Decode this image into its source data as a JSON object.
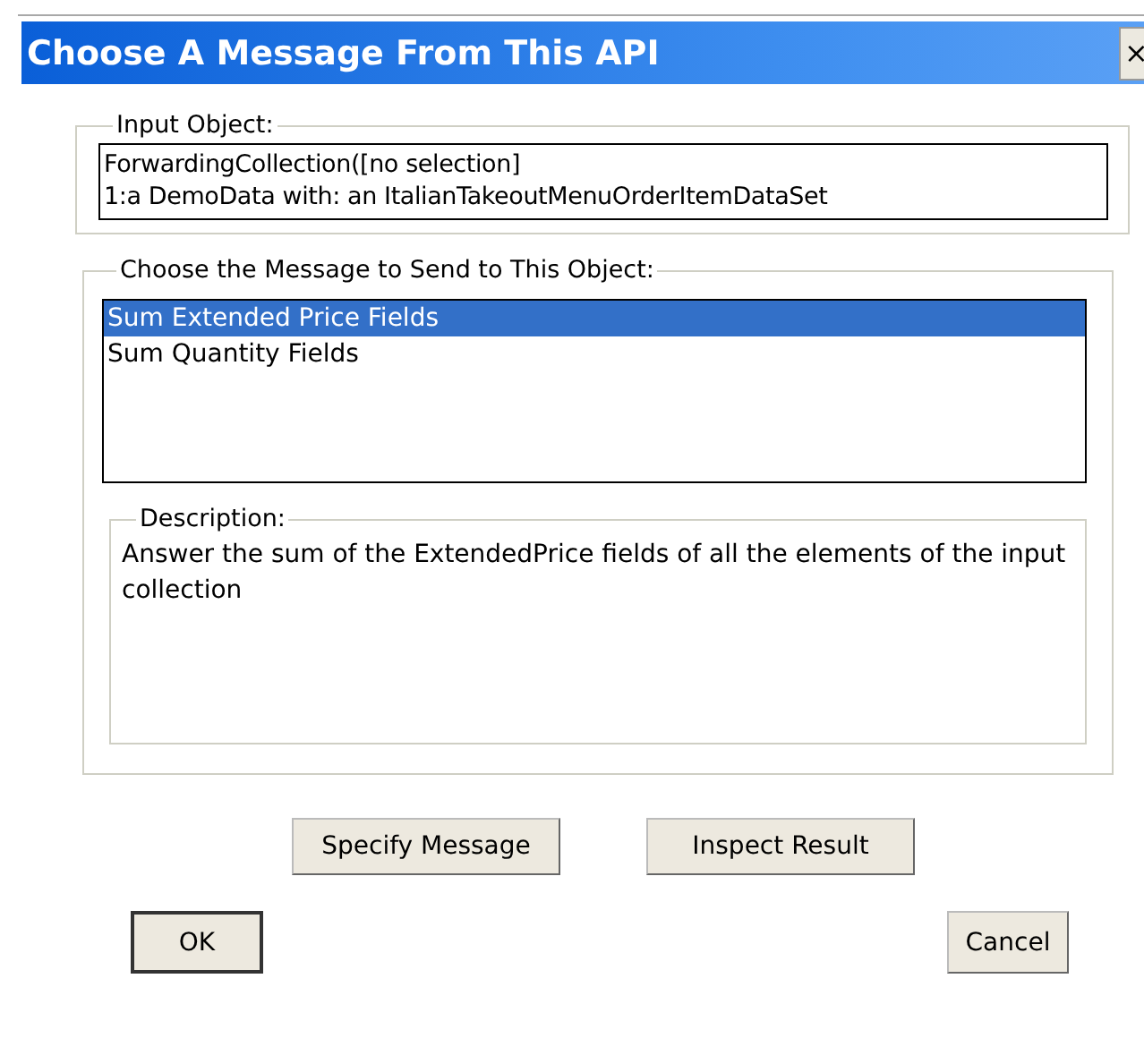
{
  "window": {
    "title": "Choose A Message From This API",
    "close": "×"
  },
  "input_object": {
    "label": "Input Object:",
    "lines": [
      "ForwardingCollection([no selection]",
      "1:a DemoData with: an ItalianTakeoutMenuOrderItemDataSet"
    ]
  },
  "messages": {
    "label": "Choose the Message to Send to This Object:",
    "items": [
      {
        "label": "Sum Extended Price Fields",
        "selected": true
      },
      {
        "label": "Sum Quantity Fields",
        "selected": false
      }
    ]
  },
  "description": {
    "label": "Description:",
    "text": "Answer the sum of the ExtendedPrice fields of all the elements of the input collection"
  },
  "action_buttons": [
    "Specify Message",
    "Inspect Result"
  ],
  "ok_button": "OK",
  "cancel_button": "Cancel"
}
